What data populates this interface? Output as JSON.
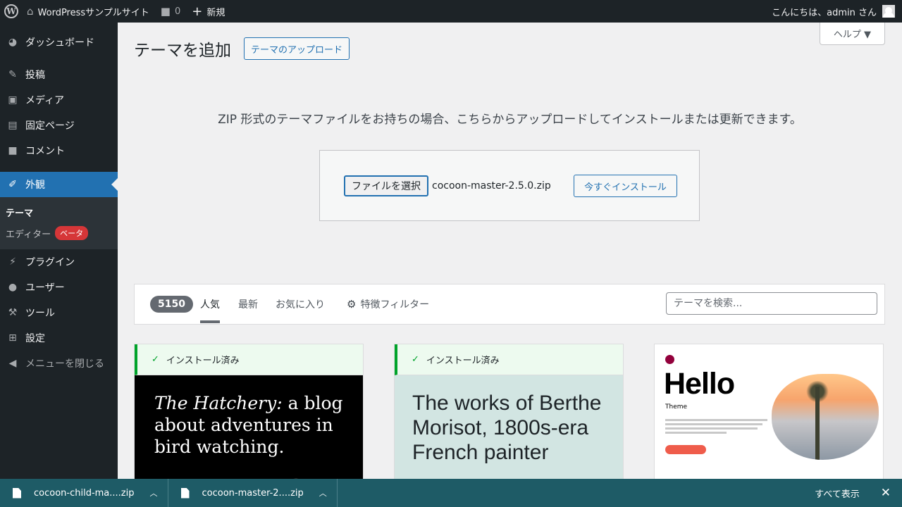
{
  "adminbar": {
    "site_name": "WordPressサンプルサイト",
    "comments_count": "0",
    "new_label": "新規",
    "greeting": "こんにちは、admin さん"
  },
  "sidebar": {
    "items": [
      {
        "label": "ダッシュボード",
        "icon": "dashboard-icon"
      },
      {
        "label": "投稿",
        "icon": "pin-icon"
      },
      {
        "label": "メディア",
        "icon": "media-icon"
      },
      {
        "label": "固定ページ",
        "icon": "page-icon"
      },
      {
        "label": "コメント",
        "icon": "comment-icon"
      },
      {
        "label": "外観",
        "icon": "brush-icon"
      },
      {
        "label": "プラグイン",
        "icon": "plugin-icon"
      },
      {
        "label": "ユーザー",
        "icon": "user-icon"
      },
      {
        "label": "ツール",
        "icon": "wrench-icon"
      },
      {
        "label": "設定",
        "icon": "settings-icon"
      },
      {
        "label": "メニューを閉じる",
        "icon": "collapse-icon"
      }
    ],
    "submenu": {
      "themes": "テーマ",
      "editor": "エディター",
      "beta": "ベータ"
    }
  },
  "help_tab": "ヘルプ ▼",
  "page": {
    "title": "テーマを追加",
    "upload_button": "テーマのアップロード",
    "upload_description": "ZIP 形式のテーマファイルをお持ちの場合、こちらからアップロードしてインストールまたは更新できます。",
    "choose_file": "ファイルを選択",
    "file_name": "cocoon-master-2.5.0.zip",
    "install_now": "今すぐインストール"
  },
  "filter": {
    "count": "5150",
    "tabs": [
      "人気",
      "最新",
      "お気に入り"
    ],
    "feature_filter": "特徴フィルター",
    "search_placeholder": "テーマを検索..."
  },
  "themes": {
    "installed_label": "インストール済み",
    "hatchery": {
      "italic": "The Hatchery:",
      "rest": " a blog about adventures in bird watching."
    },
    "morisot": "The works of Berthe Morisot, 1800s-era French painter",
    "hello": {
      "title": "Hello",
      "subtitle": "Theme"
    }
  },
  "downloads": {
    "items": [
      "cocoon-child-ma....zip",
      "cocoon-master-2....zip"
    ],
    "show_all": "すべて表示",
    "close": "✕"
  },
  "colors": {
    "admin_dark": "#1d2327",
    "accent": "#2271b1",
    "installed_green": "#00a32a",
    "download_bar": "#1e5b66"
  }
}
